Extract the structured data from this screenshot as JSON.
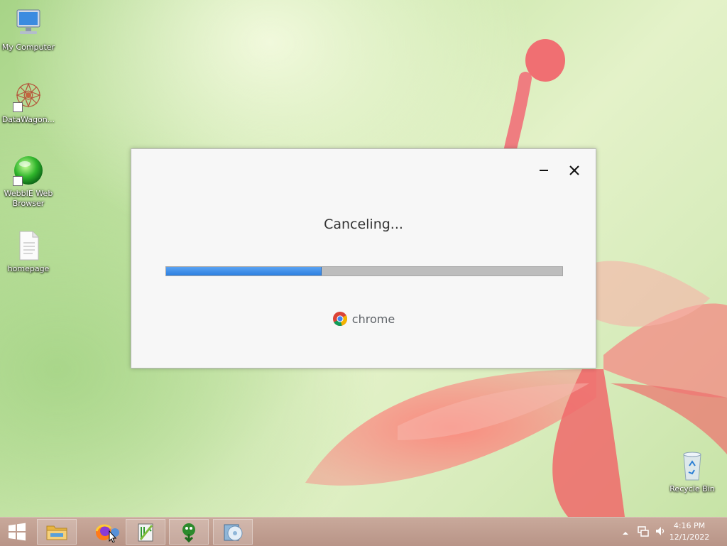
{
  "desktop": {
    "icons": [
      {
        "label": "My Computer"
      },
      {
        "label": "DataWagon..."
      },
      {
        "label": "WebbIE Web Browser"
      },
      {
        "label": "homepage"
      },
      {
        "label": "Recycle Bin"
      }
    ]
  },
  "dialog": {
    "status": "Canceling...",
    "progress_percent": 39,
    "brand": "chrome",
    "minimize_icon": "minimize-icon",
    "close_icon": "close-icon"
  },
  "taskbar": {
    "items": [
      "start-icon",
      "file-explorer-icon",
      "firefox-icon",
      "notepad-plus-plus-icon",
      "download-manager-icon",
      "installer-disc-icon"
    ],
    "tray": {
      "time": "4:16 PM",
      "date": "12/1/2022"
    }
  },
  "colors": {
    "progress_fill": "#2c7fe0",
    "progress_track": "#bdbdbd",
    "taskbar": "#c0a092"
  }
}
